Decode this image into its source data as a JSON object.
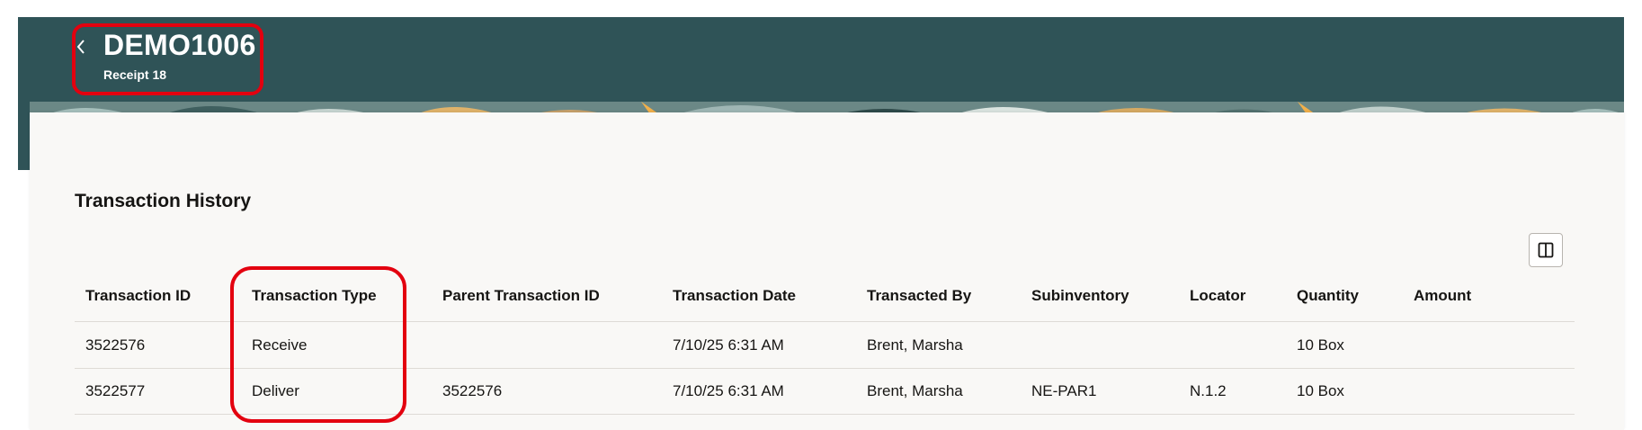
{
  "header": {
    "back_icon": "chevron-left-icon",
    "title": "DEMO1006",
    "subtitle": "Receipt 18",
    "colors": {
      "banner": "#2f5357",
      "highlight": "#e3000f"
    }
  },
  "section": {
    "title": "Transaction History",
    "columns_icon": "column-layout-icon"
  },
  "table": {
    "columns": [
      "Transaction ID",
      "Transaction Type",
      "Parent Transaction ID",
      "Transaction Date",
      "Transacted By",
      "Subinventory",
      "Locator",
      "Quantity",
      "Amount"
    ],
    "rows": [
      [
        "3522576",
        "Receive",
        "",
        "7/10/25 6:31 AM",
        "Brent, Marsha",
        "",
        "",
        "10 Box",
        ""
      ],
      [
        "3522577",
        "Deliver",
        "3522576",
        "7/10/25 6:31 AM",
        "Brent, Marsha",
        "NE-PAR1",
        "N.1.2",
        "10 Box",
        ""
      ]
    ]
  }
}
